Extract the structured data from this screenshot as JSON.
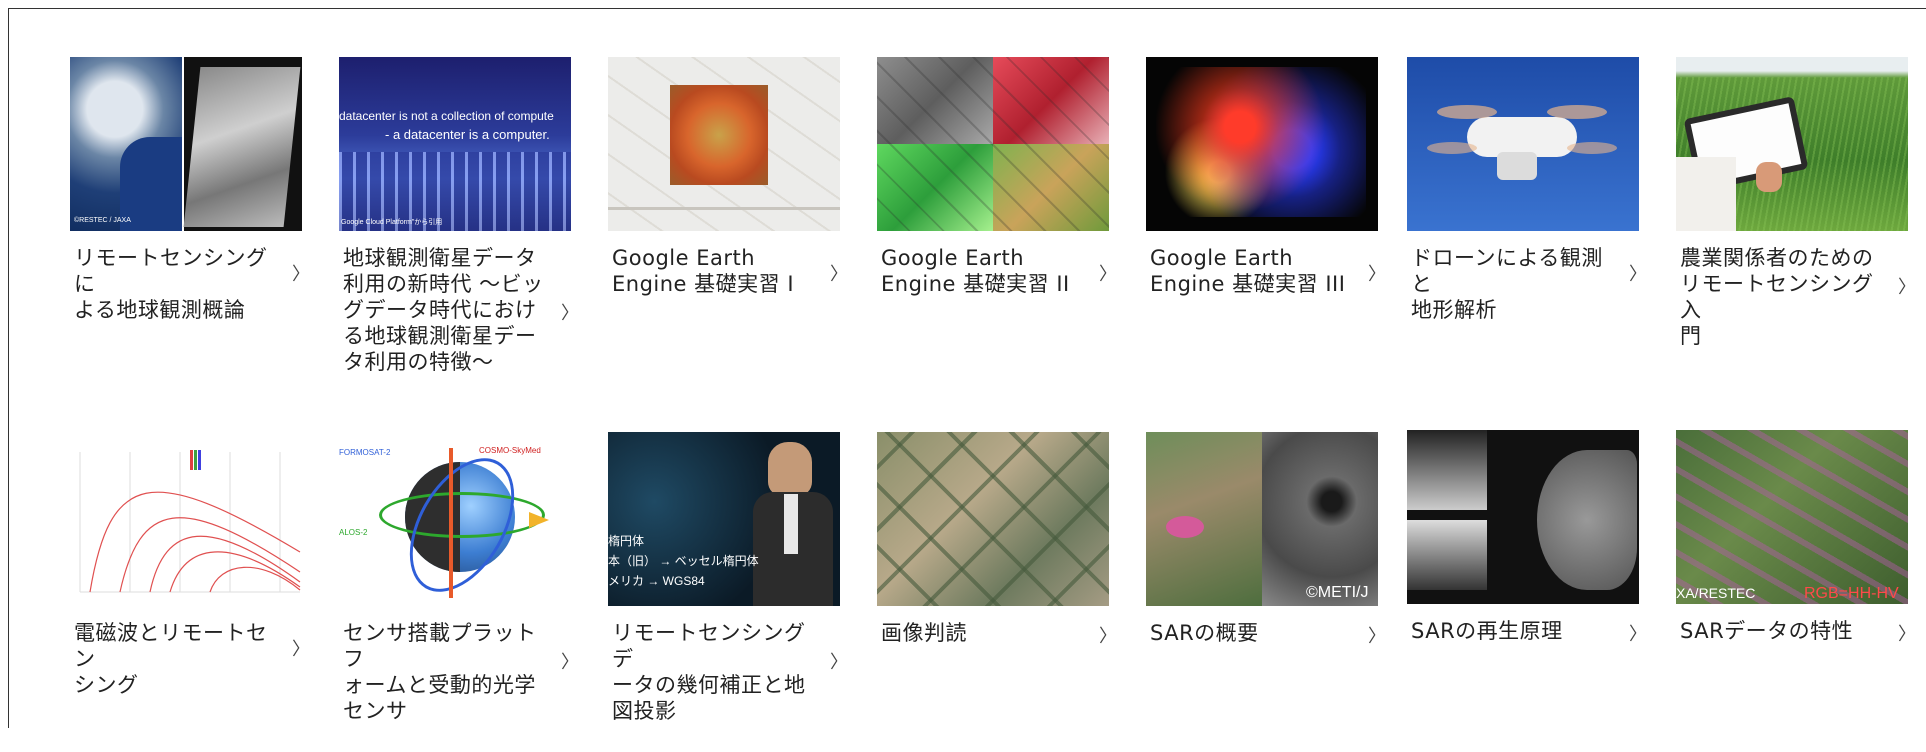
{
  "courses_row1": [
    {
      "title": "リモートセンシングに\nよる地球観測概論",
      "icon": "chevron-right-icon",
      "thumb_caption": "©RESTEC / JAXA"
    },
    {
      "title": "地球観測衛星データ\n利用の新時代 ～ビッ\nグデータ時代におけ\nる地球観測衛星デー\nタ利用の特徴～",
      "icon": "chevron-right-icon",
      "thumb_line1": "datacenter is not a collection of compute",
      "thumb_line2": "- a datacenter is a computer.",
      "thumb_caption": "Google Cloud Platform\"から引用"
    },
    {
      "title": "Google Earth\nEngine 基礎実習 I",
      "icon": "chevron-right-icon"
    },
    {
      "title": "Google Earth\nEngine 基礎実習 II",
      "icon": "chevron-right-icon"
    },
    {
      "title": "Google Earth\nEngine 基礎実習 III",
      "icon": "chevron-right-icon"
    },
    {
      "title": "ドローンによる観測と\n地形解析",
      "icon": "chevron-right-icon"
    },
    {
      "title": "農業関係者のための\nリモートセンシング入\n門",
      "icon": "chevron-right-icon"
    }
  ],
  "courses_row2": [
    {
      "title": "電磁波とリモートセン\nシング",
      "icon": "chevron-right-icon"
    },
    {
      "title": "センサ搭載プラットフ\nォームと受動的光学\nセンサ",
      "icon": "chevron-right-icon",
      "thumb_label1": "COSMO-SkyMed",
      "thumb_label2": "FORMOSAT-2",
      "thumb_label3": "ALOS-2"
    },
    {
      "title": "リモートセンシングデ\nータの幾何補正と地\n図投影",
      "icon": "chevron-right-icon",
      "thumb_line1": "楕円体",
      "thumb_line2": "本（旧） → ベッセル楕円体",
      "thumb_line3": "メリカ → WGS84"
    },
    {
      "title": "画像判読",
      "icon": "chevron-right-icon"
    },
    {
      "title": "SARの概要",
      "icon": "chevron-right-icon",
      "thumb_caption": "©METI/J"
    },
    {
      "title": "SARの再生原理",
      "icon": "chevron-right-icon"
    },
    {
      "title": "SARデータの特性",
      "icon": "chevron-right-icon",
      "thumb_caption": "XA/RESTEC",
      "thumb_rgb": "RGB=HH-HV"
    }
  ],
  "chevron_glyph": "〉"
}
